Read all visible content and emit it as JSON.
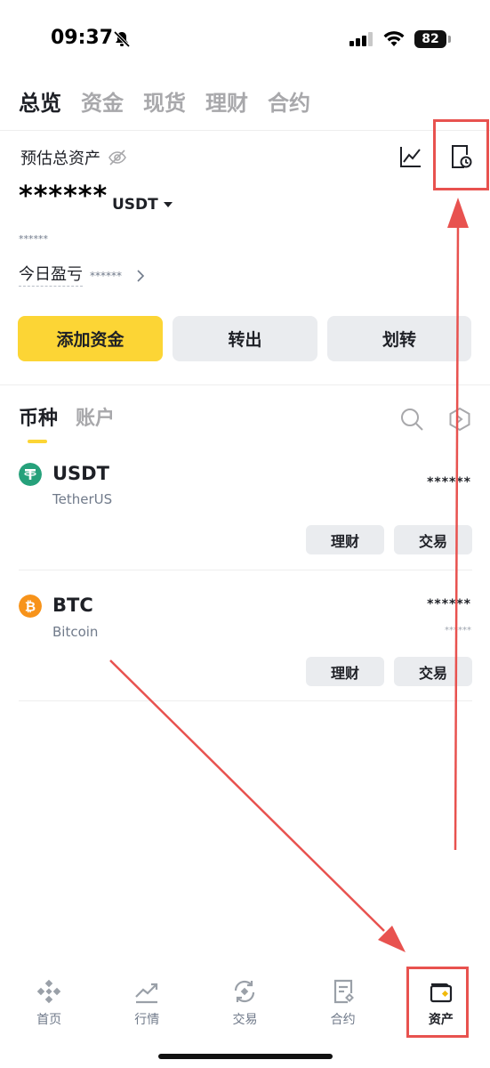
{
  "status_bar": {
    "time": "09:37",
    "battery": "82"
  },
  "top_tabs": [
    {
      "label": "总览",
      "active": true
    },
    {
      "label": "资金",
      "active": false
    },
    {
      "label": "现货",
      "active": false
    },
    {
      "label": "理财",
      "active": false
    },
    {
      "label": "合约",
      "active": false
    }
  ],
  "overview": {
    "estimated_label": "预估总资产",
    "balance_masked": "******",
    "unit": "USDT",
    "small_masked": "******",
    "pnl_label": "今日盈亏",
    "pnl_masked": "******"
  },
  "actions": {
    "add_funds": "添加资金",
    "withdraw": "转出",
    "transfer": "划转"
  },
  "asset_tabs": [
    {
      "label": "币种",
      "active": true
    },
    {
      "label": "账户",
      "active": false
    }
  ],
  "coins": [
    {
      "symbol": "USDT",
      "name": "TetherUS",
      "amount": "******",
      "sub": "",
      "btn_earn": "理财",
      "btn_trade": "交易",
      "color": "#26a17b"
    },
    {
      "symbol": "BTC",
      "name": "Bitcoin",
      "amount": "******",
      "sub": "******",
      "btn_earn": "理财",
      "btn_trade": "交易",
      "color": "#f7931a"
    }
  ],
  "bottom_nav": [
    {
      "label": "首页",
      "icon": "home-icon",
      "active": false
    },
    {
      "label": "行情",
      "icon": "markets-icon",
      "active": false
    },
    {
      "label": "交易",
      "icon": "trade-icon",
      "active": false
    },
    {
      "label": "合约",
      "icon": "futures-icon",
      "active": false
    },
    {
      "label": "资产",
      "icon": "wallet-icon",
      "active": true
    }
  ],
  "colors": {
    "accent": "#fcd535",
    "annotation": "#e8524f"
  }
}
